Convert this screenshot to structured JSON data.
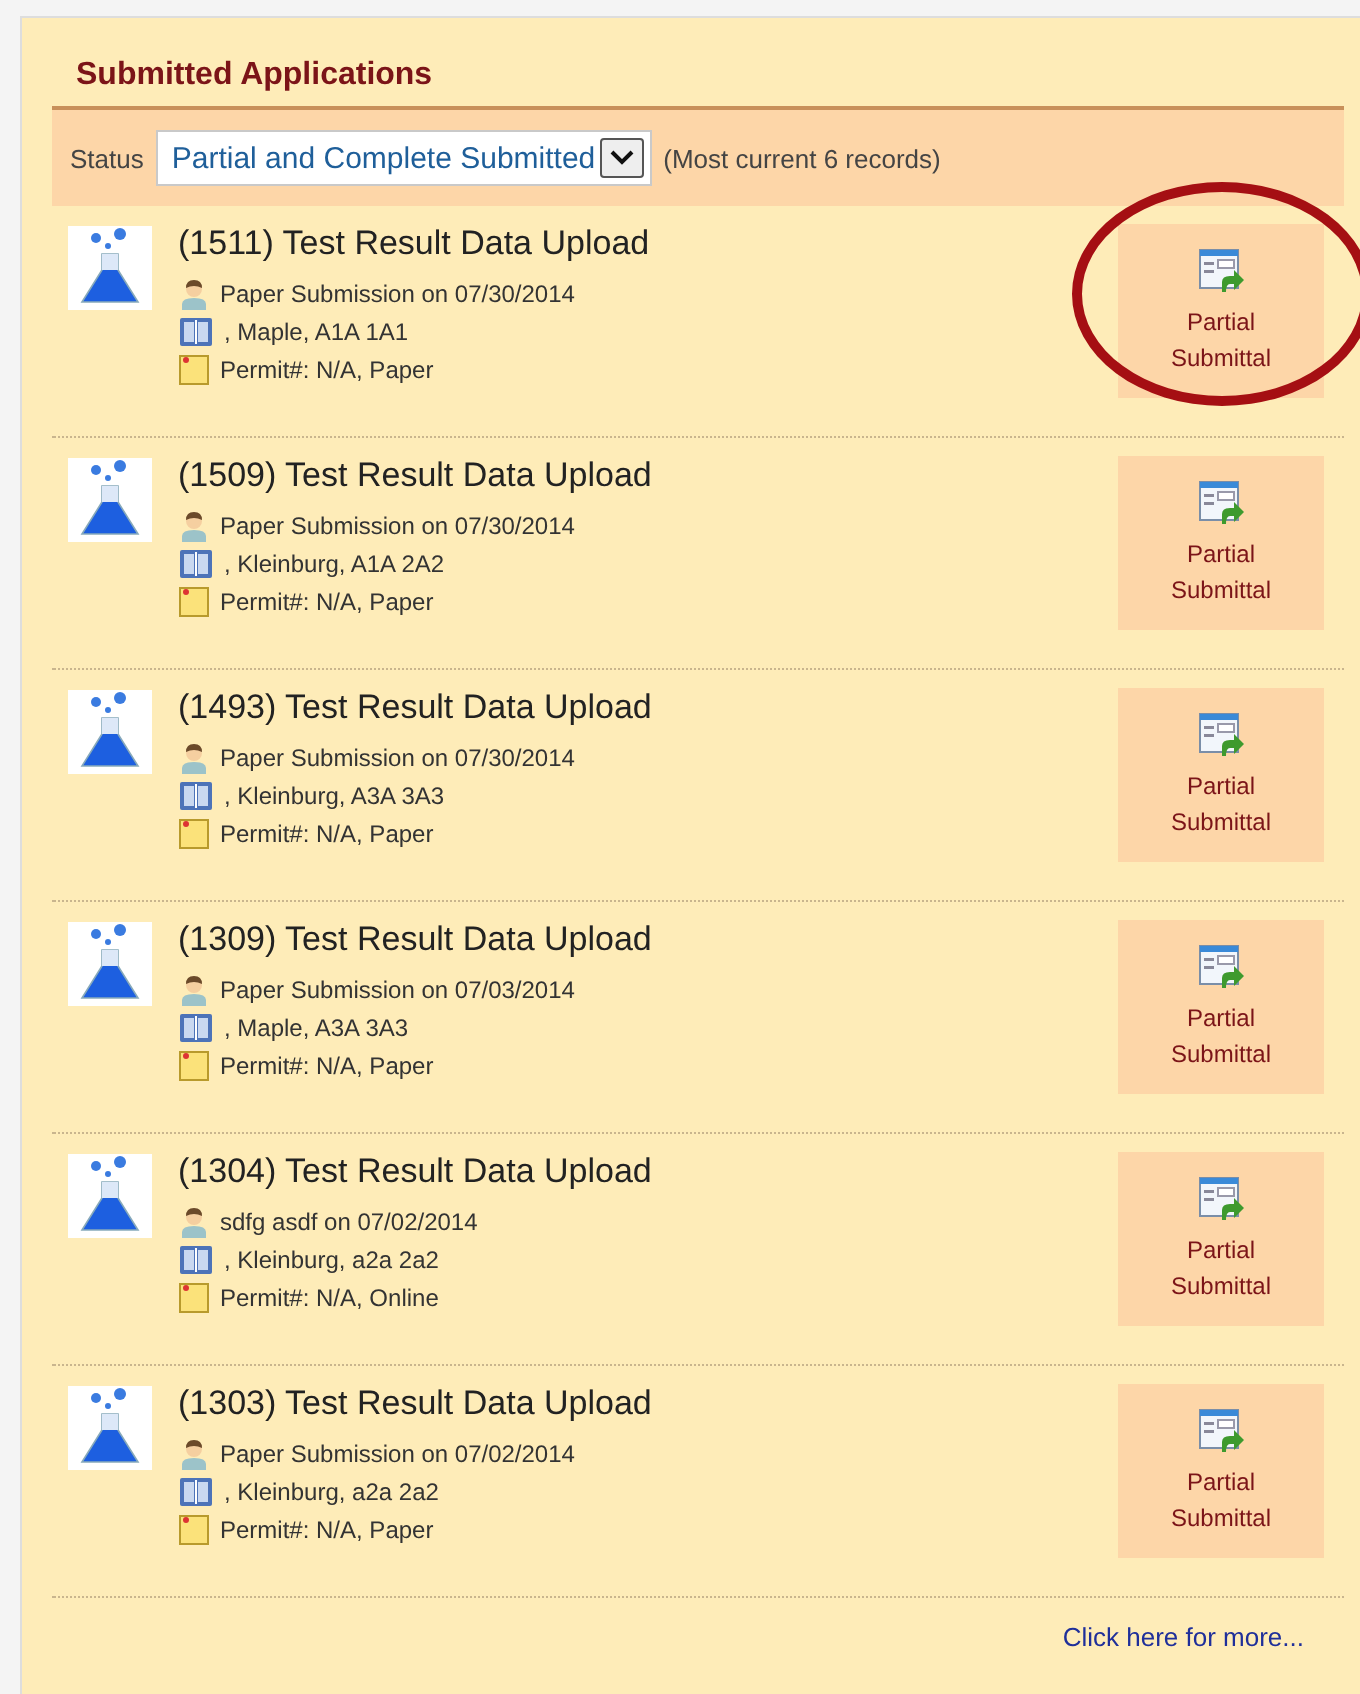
{
  "panel": {
    "title": "Submitted Applications"
  },
  "filter": {
    "label": "Status",
    "value": "Partial and Complete Submitted",
    "note": "(Most current 6 records)"
  },
  "records": [
    {
      "title": "(1511) Test Result Data Upload",
      "submitter": "Paper Submission on 07/30/2014",
      "location": ", Maple, A1A 1A1",
      "permit": "Permit#: N/A, Paper",
      "action": "Partial Submittal",
      "circled": true
    },
    {
      "title": "(1509) Test Result Data Upload",
      "submitter": "Paper Submission on 07/30/2014",
      "location": ", Kleinburg, A1A 2A2",
      "permit": "Permit#: N/A, Paper",
      "action": "Partial Submittal",
      "circled": false
    },
    {
      "title": "(1493) Test Result Data Upload",
      "submitter": "Paper Submission on 07/30/2014",
      "location": ", Kleinburg, A3A 3A3",
      "permit": "Permit#: N/A, Paper",
      "action": "Partial Submittal",
      "circled": false
    },
    {
      "title": "(1309) Test Result Data Upload",
      "submitter": "Paper Submission on 07/03/2014",
      "location": ", Maple, A3A 3A3",
      "permit": "Permit#: N/A, Paper",
      "action": "Partial Submittal",
      "circled": false
    },
    {
      "title": "(1304) Test Result Data Upload",
      "submitter": "sdfg asdf on 07/02/2014",
      "location": ", Kleinburg, a2a 2a2",
      "permit": "Permit#: N/A, Online",
      "action": "Partial Submittal",
      "circled": false
    },
    {
      "title": "(1303) Test Result Data Upload",
      "submitter": "Paper Submission on 07/02/2014",
      "location": ", Kleinburg, a2a 2a2",
      "permit": "Permit#: N/A, Paper",
      "action": "Partial Submittal",
      "circled": false
    }
  ],
  "more_link": "Click here for more..."
}
